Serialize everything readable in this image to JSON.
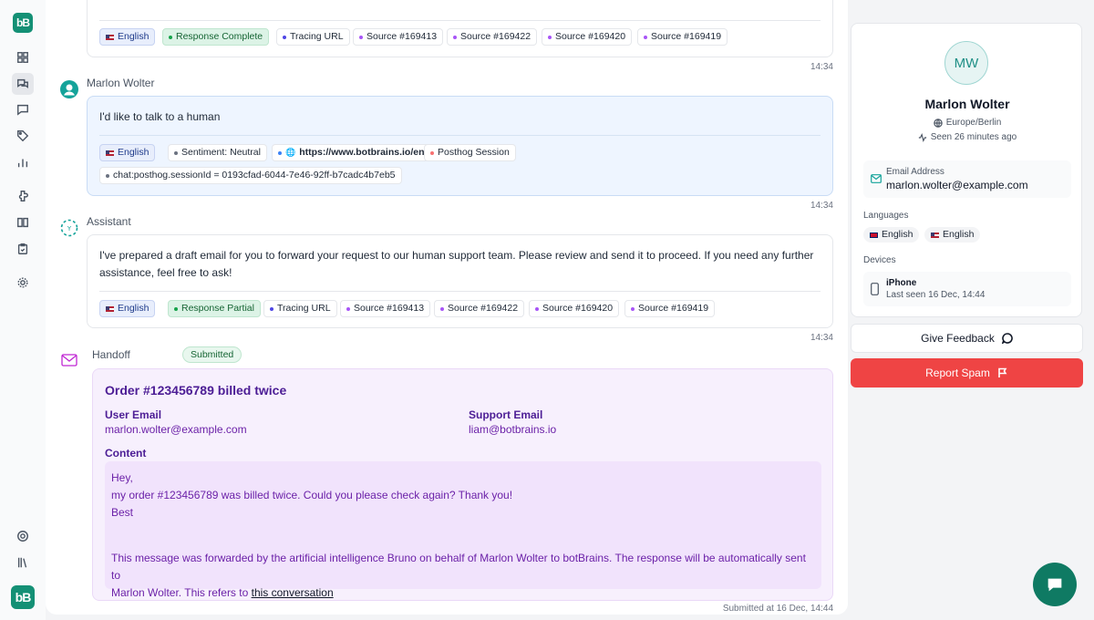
{
  "app": {
    "logo_text": "bB"
  },
  "messages": [
    {
      "id": "assistant-prev",
      "chips": [
        {
          "label": "English",
          "kind": "lang"
        },
        {
          "label": "Response Complete",
          "kind": "green"
        },
        {
          "label": "Tracing URL",
          "kind": "plain",
          "dot": "#4f46e5"
        },
        {
          "label": "Source #169413",
          "kind": "plain",
          "dot": "#a855f7"
        },
        {
          "label": "Source #169422",
          "kind": "plain",
          "dot": "#a855f7"
        },
        {
          "label": "Source #169420",
          "kind": "plain",
          "dot": "#a855f7"
        },
        {
          "label": "Source #169419",
          "kind": "plain",
          "dot": "#a855f7"
        }
      ],
      "time": "14:34"
    },
    {
      "id": "user",
      "author": "Marlon Wolter",
      "text": "I'd like to talk to a human",
      "chips": [
        {
          "label": "English",
          "kind": "lang"
        },
        {
          "label": "Sentiment: Neutral",
          "kind": "plain",
          "dot": "#6b7280"
        },
        {
          "label": "https://www.botbrains.io/en",
          "kind": "plain",
          "dot": "#3b82f6"
        },
        {
          "label": "Posthog Session",
          "kind": "plain",
          "dot": "#f87171"
        },
        {
          "label": "chat:posthog.sessionId = 0193cfad-6044-7e46-92ff-b7cadc4b7eb5",
          "kind": "plain",
          "dot": "#6b7280"
        }
      ],
      "time": "14:34"
    },
    {
      "id": "assistant",
      "author": "Assistant",
      "text_line1": "I've prepared a draft email for you to forward your request to our human support team. Please review and send it to proceed. If you need any further",
      "text_line2": "assistance, feel free to ask!",
      "chips": [
        {
          "label": "English",
          "kind": "lang"
        },
        {
          "label": "Response Partial",
          "kind": "green"
        },
        {
          "label": "Tracing URL",
          "kind": "plain",
          "dot": "#4f46e5"
        },
        {
          "label": "Source #169413",
          "kind": "plain",
          "dot": "#a855f7"
        },
        {
          "label": "Source #169422",
          "kind": "plain",
          "dot": "#a855f7"
        },
        {
          "label": "Source #169420",
          "kind": "plain",
          "dot": "#a855f7"
        },
        {
          "label": "Source #169419",
          "kind": "plain",
          "dot": "#a855f7"
        }
      ],
      "time": "14:34"
    }
  ],
  "handoff": {
    "label": "Handoff",
    "status": "Submitted",
    "title": "Order #123456789 billed twice",
    "user_email_label": "User Email",
    "user_email": "marlon.wolter@example.com",
    "support_email_label": "Support Email",
    "support_email": "liam@botbrains.io",
    "content_label": "Content",
    "content_line1": "Hey,",
    "content_line2": "my order #123456789 was billed twice. Could you please check again? Thank you!",
    "content_line3": "Best",
    "footer_line1": "This message was forwarded by the artificial intelligence Bruno on behalf of Marlon Wolter to botBrains. The response will be automatically sent to",
    "footer_line2_prefix": "Marlon Wolter. This refers to ",
    "footer_link": "this conversation",
    "submitted_at": "Submitted at 16 Dec, 14:44"
  },
  "profile": {
    "initials": "MW",
    "name": "Marlon Wolter",
    "timezone": "Europe/Berlin",
    "seen": "Seen 26 minutes ago",
    "email_label": "Email Address",
    "email": "marlon.wolter@example.com",
    "languages_label": "Languages",
    "languages": [
      "English",
      "English"
    ],
    "devices_label": "Devices",
    "device_name": "iPhone",
    "device_seen": "Last seen 16 Dec, 14:44"
  },
  "actions": {
    "feedback": "Give Feedback",
    "spam": "Report Spam"
  },
  "colors": {
    "brand": "#149075",
    "danger": "#ef4444",
    "handoff_text": "#6b21a8"
  }
}
